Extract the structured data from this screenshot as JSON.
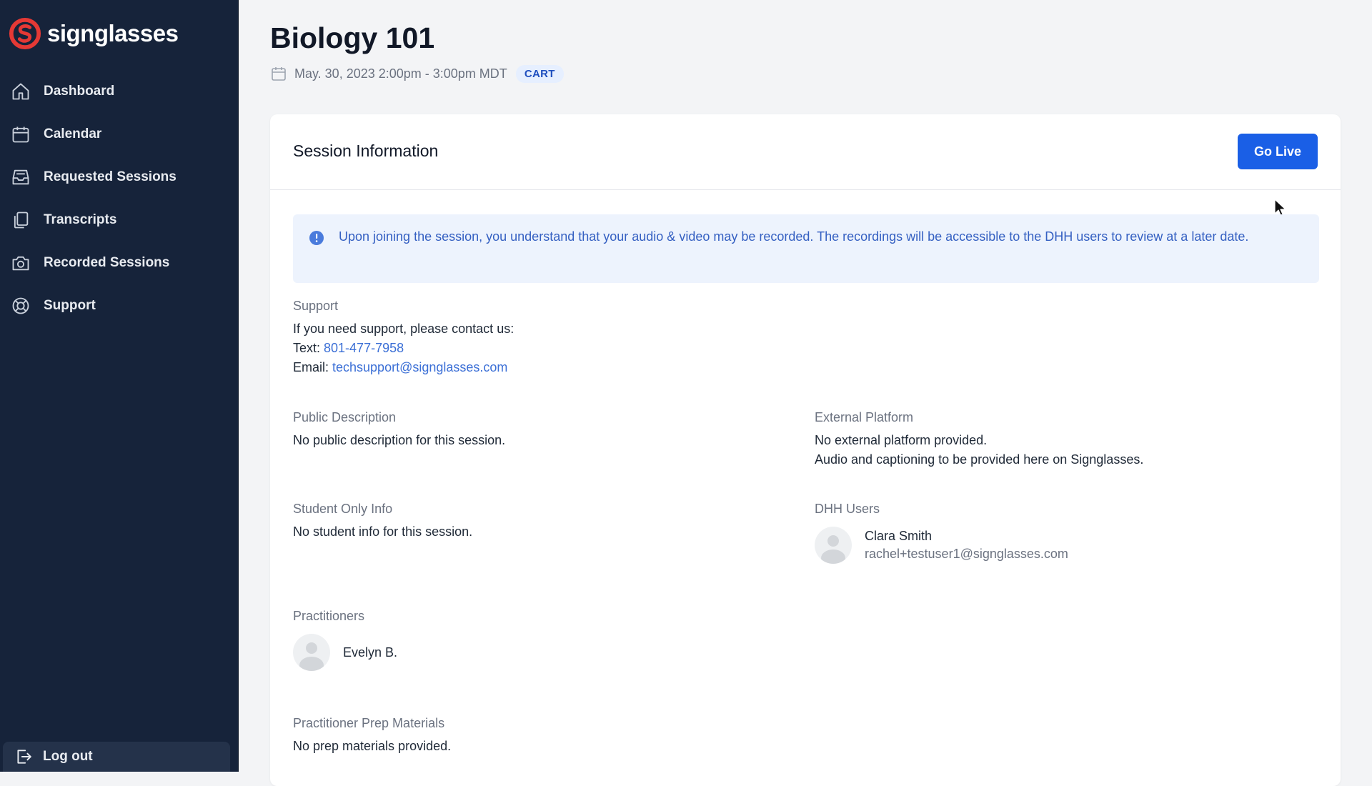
{
  "brand": {
    "name": "signglasses",
    "accent": "#e53935"
  },
  "sidebar": {
    "items": [
      {
        "label": "Dashboard",
        "icon": "home-icon"
      },
      {
        "label": "Calendar",
        "icon": "calendar-icon"
      },
      {
        "label": "Requested Sessions",
        "icon": "inbox-icon"
      },
      {
        "label": "Transcripts",
        "icon": "documents-icon"
      },
      {
        "label": "Recorded Sessions",
        "icon": "camera-icon"
      },
      {
        "label": "Support",
        "icon": "lifebuoy-icon"
      }
    ],
    "logout_label": "Log out"
  },
  "session": {
    "title": "Biology 101",
    "datetime": "May. 30, 2023 2:00pm - 3:00pm MDT",
    "badge": "CART"
  },
  "card": {
    "title": "Session Information",
    "go_live_label": "Go Live",
    "notice": "Upon joining the session, you understand that your audio & video may be recorded. The recordings will be accessible to the DHH users to review at a later date."
  },
  "support": {
    "label": "Support",
    "intro": "If you need support, please contact us:",
    "text_prefix": "Text: ",
    "phone": "801-477-7958",
    "email_prefix": "Email: ",
    "email": "techsupport@signglasses.com"
  },
  "public_description": {
    "label": "Public Description",
    "value": "No public description for this session."
  },
  "external_platform": {
    "label": "External Platform",
    "line1": "No external platform provided.",
    "line2": "Audio and captioning to be provided here on Signglasses."
  },
  "student_info": {
    "label": "Student Only Info",
    "value": "No student info for this session."
  },
  "dhh_users": {
    "label": "DHH Users",
    "users": [
      {
        "name": "Clara Smith",
        "email": "rachel+testuser1@signglasses.com"
      }
    ]
  },
  "practitioners": {
    "label": "Practitioners",
    "people": [
      {
        "name": "Evelyn B."
      }
    ]
  },
  "prep_materials": {
    "label": "Practitioner Prep Materials",
    "value": "No prep materials provided."
  },
  "colors": {
    "sidebar_bg": "#16233a",
    "primary_button": "#1a5fe6",
    "notice_bg": "#edf3fd",
    "notice_text": "#3560c2",
    "link": "#3b6fd6"
  }
}
